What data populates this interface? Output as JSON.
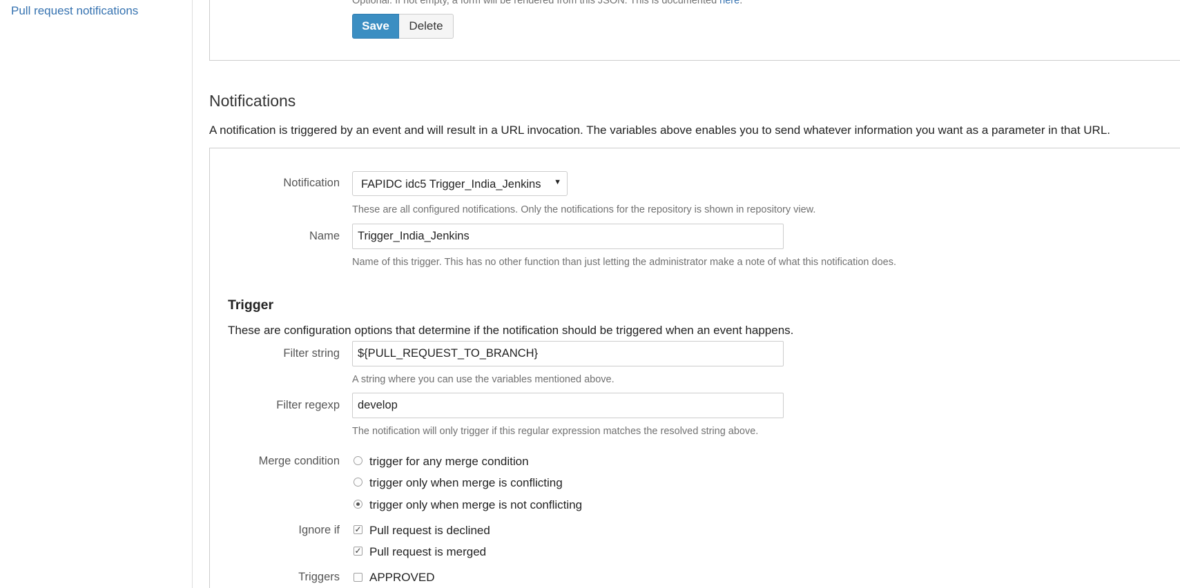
{
  "sidebar": {
    "link_label": "Pull request notifications"
  },
  "form_top": {
    "hint_text": "Optional. If not empty, a form will be rendered from this JSON. This is documented ",
    "hint_link": "here",
    "hint_end": ".",
    "save_label": "Save",
    "delete_label": "Delete"
  },
  "notifications": {
    "title": "Notifications",
    "description": "A notification is triggered by an event and will result in a URL invocation. The variables above enables you to send whatever information you want as a parameter in that URL.",
    "notification_label": "Notification",
    "notification_selected": "FAPIDC idc5 Trigger_India_Jenkins",
    "notification_hint": "These are all configured notifications. Only the notifications for the repository is shown in repository view.",
    "name_label": "Name",
    "name_value": "Trigger_India_Jenkins",
    "name_hint": "Name of this trigger. This has no other function than just letting the administrator make a note of what this notification does."
  },
  "trigger": {
    "title": "Trigger",
    "description": "These are configuration options that determine if the notification should be triggered when an event happens.",
    "filter_string_label": "Filter string",
    "filter_string_value": "${PULL_REQUEST_TO_BRANCH}",
    "filter_string_hint": "A string where you can use the variables mentioned above.",
    "filter_regexp_label": "Filter regexp",
    "filter_regexp_value": "develop",
    "filter_regexp_hint": "The notification will only trigger if this regular expression matches the resolved string above.",
    "merge_condition_label": "Merge condition",
    "merge_options": [
      {
        "label": "trigger for any merge condition",
        "checked": false
      },
      {
        "label": "trigger only when merge is conflicting",
        "checked": false
      },
      {
        "label": "trigger only when merge is not conflicting",
        "checked": true
      }
    ],
    "ignore_if_label": "Ignore if",
    "ignore_options": [
      {
        "label": "Pull request is declined",
        "checked": true
      },
      {
        "label": "Pull request is merged",
        "checked": true
      }
    ],
    "triggers_label": "Triggers",
    "triggers_options": [
      {
        "label": "APPROVED",
        "checked": false
      }
    ]
  },
  "colors": {
    "link": "#3572b0",
    "primary_button": "#3b8ec2"
  }
}
